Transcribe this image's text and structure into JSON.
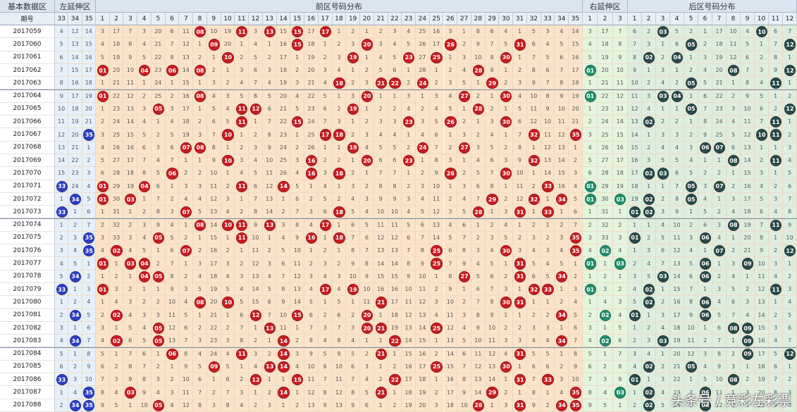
{
  "header": {
    "base_title": "基本数据区",
    "period_label": "期号",
    "groups": [
      "左延伸区",
      "前区号码分布",
      "右延伸区",
      "后区号码分布"
    ],
    "left_ext_cols": [
      "33",
      "34",
      "35"
    ],
    "front_cols": [
      "1",
      "2",
      "3",
      "4",
      "5",
      "6",
      "7",
      "8",
      "9",
      "10",
      "11",
      "12",
      "13",
      "14",
      "15",
      "16",
      "17",
      "18",
      "19",
      "20",
      "21",
      "22",
      "23",
      "24",
      "25",
      "26",
      "27",
      "28",
      "29",
      "30",
      "31",
      "32",
      "33",
      "34",
      "35"
    ],
    "right_ext_cols": [
      "1",
      "2",
      "3"
    ],
    "back_cols": [
      "1",
      "2",
      "3",
      "4",
      "5",
      "6",
      "7",
      "8",
      "9",
      "10",
      "11",
      "12"
    ]
  },
  "colors": {
    "left_ext_hit": "#2b3fc4",
    "front_hit": "#c81c22",
    "right_ext_hit": "#1f8f6a",
    "back_hit": "#2a4a4a",
    "front_bg": "#fbe3c9",
    "left_bg": "#e6f0fb",
    "right_bg": "#e5f4dc",
    "back_bg": "#ddeede"
  },
  "rows": [
    {
      "period": "2017059",
      "front": [
        8,
        11,
        13,
        15,
        17
      ],
      "back": [
        3,
        10
      ]
    },
    {
      "period": "2017060",
      "front": [
        9,
        15,
        20,
        26,
        31
      ],
      "back": [
        5,
        12
      ]
    },
    {
      "period": "2017061",
      "front": [
        10,
        19,
        23,
        25,
        30
      ],
      "back": [
        2,
        4
      ]
    },
    {
      "period": "2017062",
      "front": [
        1,
        4,
        6,
        8,
        28
      ],
      "back": [
        8,
        12
      ]
    },
    {
      "period": "2017063",
      "front": [
        18,
        21,
        22,
        24,
        29
      ],
      "back": [
        5,
        11
      ]
    },
    {
      "period": "2017064",
      "front": [
        1,
        8,
        20,
        27,
        30
      ],
      "back": [
        3,
        4
      ]
    },
    {
      "period": "2017065",
      "front": [
        5,
        11,
        12,
        19,
        28
      ],
      "back": [
        5,
        12
      ]
    },
    {
      "period": "2017066",
      "front": [
        11,
        15,
        23,
        26,
        30
      ],
      "back": [
        2,
        11
      ]
    },
    {
      "period": "2017067",
      "front": [
        10,
        17,
        18,
        32,
        35
      ],
      "back": [
        10,
        11
      ]
    },
    {
      "period": "2017068",
      "front": [
        7,
        8,
        19,
        24,
        27
      ],
      "back": [
        6,
        7
      ]
    },
    {
      "period": "2017069",
      "front": [
        10,
        16,
        20,
        23,
        32
      ],
      "back": [
        8,
        11
      ]
    },
    {
      "period": "2017070",
      "front": [
        6,
        16,
        18,
        26,
        30
      ],
      "back": [
        2,
        3
      ]
    },
    {
      "period": "2017071",
      "front": [
        1,
        4,
        11,
        14,
        33
      ],
      "back": [
        5,
        7
      ]
    },
    {
      "period": "2017072",
      "front": [
        1,
        3,
        29,
        32,
        34
      ],
      "back": [
        2,
        5
      ]
    },
    {
      "period": "2017073",
      "front": [
        7,
        18,
        28,
        31,
        33
      ],
      "back": [
        1,
        2
      ]
    },
    {
      "period": "2017074",
      "front": [
        8,
        10,
        11,
        13,
        17
      ],
      "back": [
        8,
        11
      ]
    },
    {
      "period": "2017075",
      "front": [
        5,
        11,
        16,
        18,
        35
      ],
      "back": [
        1,
        6
      ]
    },
    {
      "period": "2017076",
      "front": [
        2,
        7,
        25,
        30,
        35
      ],
      "back": [
        7,
        12
      ]
    },
    {
      "period": "2017077",
      "front": [
        1,
        3,
        4,
        25,
        31
      ],
      "back": [
        6,
        9
      ]
    },
    {
      "period": "2017078",
      "front": [
        4,
        5,
        27,
        31,
        34
      ],
      "back": [
        3,
        6
      ]
    },
    {
      "period": "2017079",
      "front": [
        1,
        17,
        19,
        32,
        33
      ],
      "back": [
        2,
        11
      ]
    },
    {
      "period": "2017080",
      "front": [
        8,
        10,
        21,
        30,
        31
      ],
      "back": [
        2,
        6
      ]
    },
    {
      "period": "2017081",
      "front": [
        2,
        12,
        15,
        20,
        34
      ],
      "back": [
        1,
        6
      ]
    },
    {
      "period": "2017082",
      "front": [
        5,
        13,
        20,
        21,
        25
      ],
      "back": [
        8,
        9
      ]
    },
    {
      "period": "2017083",
      "front": [
        2,
        5,
        14,
        22,
        34
      ],
      "back": [
        3,
        9
      ]
    },
    {
      "period": "2017084",
      "front": [
        6,
        11,
        14,
        21,
        31
      ],
      "back": [
        9,
        12
      ]
    },
    {
      "period": "2017085",
      "front": [
        9,
        13,
        14,
        25,
        30
      ],
      "back": [
        2,
        5
      ]
    },
    {
      "period": "2017086",
      "front": [
        12,
        15,
        22,
        31,
        33
      ],
      "back": [
        1,
        8
      ]
    },
    {
      "period": "2017087",
      "front": [
        3,
        14,
        21,
        29,
        35
      ],
      "back": [
        2,
        6
      ]
    },
    {
      "period": "2017088",
      "front": [
        5,
        28,
        31,
        34,
        35
      ],
      "back": [
        2,
        6
      ]
    }
  ],
  "watermark": "头条号 / 竞彩左彩票"
}
